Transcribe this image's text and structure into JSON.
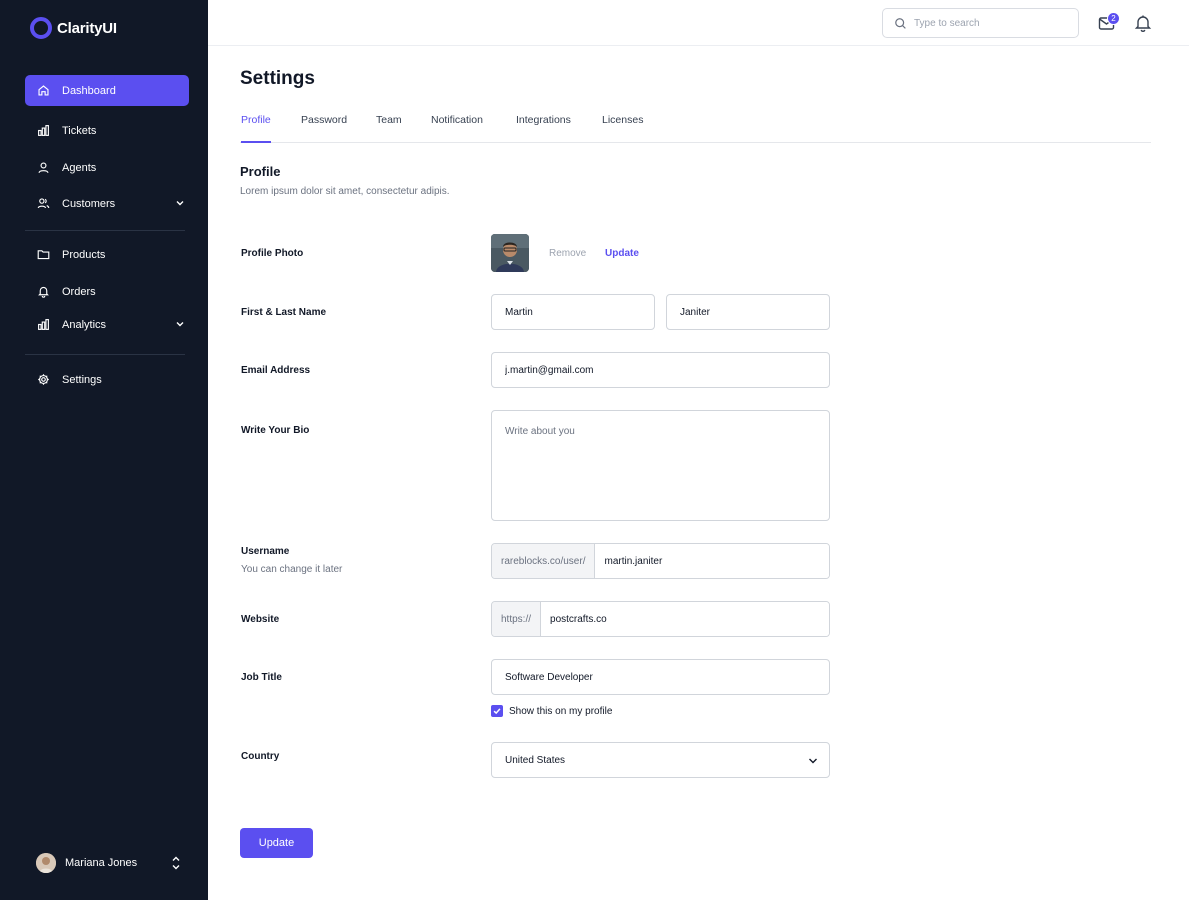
{
  "app": {
    "name": "ClarityUI"
  },
  "sidebar": {
    "items": [
      {
        "label": "Dashboard",
        "icon": "home-icon",
        "active": true
      },
      {
        "label": "Tickets",
        "icon": "bar-chart-icon"
      },
      {
        "label": "Agents",
        "icon": "user-icon"
      },
      {
        "label": "Customers",
        "icon": "users-icon",
        "expandable": true
      },
      {
        "label": "Products",
        "icon": "folder-icon"
      },
      {
        "label": "Orders",
        "icon": "bell-icon"
      },
      {
        "label": "Analytics",
        "icon": "bar-chart-icon",
        "expandable": true
      },
      {
        "label": "Settings",
        "icon": "gear-icon"
      }
    ],
    "user": {
      "name": "Mariana Jones"
    }
  },
  "topbar": {
    "search_placeholder": "Type to search",
    "mail_badge": "2"
  },
  "page": {
    "title": "Settings",
    "tabs": [
      {
        "label": "Profile",
        "active": true
      },
      {
        "label": "Password"
      },
      {
        "label": "Team"
      },
      {
        "label": "Notification"
      },
      {
        "label": "Integrations"
      },
      {
        "label": "Licenses"
      }
    ],
    "section_title": "Profile",
    "section_desc": "Lorem ipsum dolor sit amet, consectetur adipis."
  },
  "form": {
    "photo_label": "Profile Photo",
    "photo_remove": "Remove",
    "photo_update": "Update",
    "name_label": "First & Last Name",
    "first_name": "Martin",
    "last_name": "Janiter",
    "email_label": "Email Address",
    "email": "j.martin@gmail.com",
    "bio_label": "Write Your Bio",
    "bio_placeholder": "Write about you",
    "username_label": "Username",
    "username_hint": "You can change it later",
    "username_prefix": "rareblocks.co/user/",
    "username": "martin.janiter",
    "website_label": "Website",
    "website_prefix": "https://",
    "website": "postcrafts.co",
    "job_label": "Job Title",
    "job": "Software Developer",
    "show_on_profile": "Show this on my profile",
    "show_on_profile_checked": true,
    "country_label": "Country",
    "country": "United States",
    "submit": "Update"
  },
  "colors": {
    "accent": "#5b4ff0",
    "sidebar_bg": "#111827"
  }
}
